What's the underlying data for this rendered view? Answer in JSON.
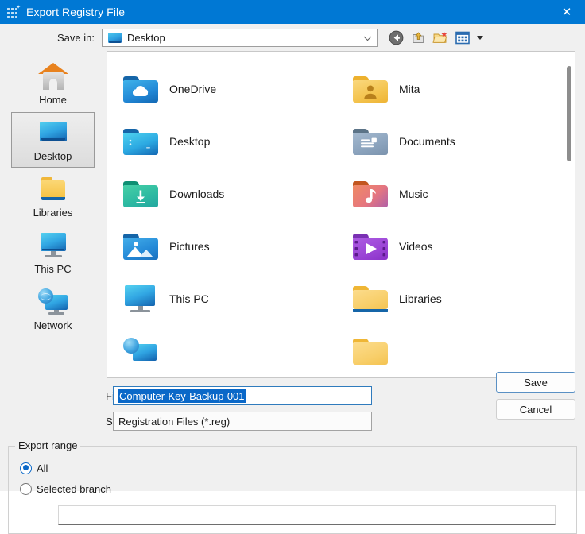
{
  "window": {
    "title": "Export Registry File",
    "title_icon": "registry-grid-icon",
    "close_label": "✕",
    "accent_color": "#0078d4"
  },
  "savein": {
    "label": "Save in:",
    "value": "Desktop",
    "icon": "desktop-monitor-icon"
  },
  "toolbar": [
    {
      "name": "back-icon",
      "tooltip": "Back"
    },
    {
      "name": "up-folder-icon",
      "tooltip": "Up one level"
    },
    {
      "name": "new-folder-icon",
      "tooltip": "Create New Folder"
    },
    {
      "name": "views-icon",
      "tooltip": "Views"
    }
  ],
  "places": [
    {
      "label": "Home",
      "icon": "home-icon",
      "selected": false
    },
    {
      "label": "Desktop",
      "icon": "desktop-icon",
      "selected": true
    },
    {
      "label": "Libraries",
      "icon": "libraries-folder-icon",
      "selected": false
    },
    {
      "label": "This PC",
      "icon": "this-pc-icon",
      "selected": false
    },
    {
      "label": "Network",
      "icon": "network-icon",
      "selected": false
    }
  ],
  "files": [
    {
      "name": "OneDrive",
      "icon": "onedrive-folder-icon",
      "color": "#2b9ae0",
      "tab": "#1565a8",
      "glyph": "cloud"
    },
    {
      "name": "Mita",
      "icon": "user-folder-icon",
      "color": "#f5c757",
      "tab": "#edb12e",
      "glyph": "person"
    },
    {
      "name": "Desktop",
      "icon": "desktop-folder-icon",
      "color": "#2fb6e0",
      "tab": "#1565a8",
      "glyph": "bars"
    },
    {
      "name": "Documents",
      "icon": "documents-folder-icon",
      "color": "#8ba3bd",
      "tab": "#5b7387",
      "glyph": "doc"
    },
    {
      "name": "Downloads",
      "icon": "downloads-folder-icon",
      "color": "#2fbfa0",
      "tab": "#0e8f73",
      "glyph": "arrow-down"
    },
    {
      "name": "Music",
      "icon": "music-folder-icon",
      "color": "#e98071",
      "tab": "#c2561f",
      "glyph": "note"
    },
    {
      "name": "Pictures",
      "icon": "pictures-folder-icon",
      "color": "#2b9ae0",
      "tab": "#1565a8",
      "glyph": "image"
    },
    {
      "name": "Videos",
      "icon": "videos-folder-icon",
      "color": "#9b45d6",
      "tab": "#7a31b3",
      "glyph": "play"
    },
    {
      "name": "This PC",
      "icon": "this-pc-icon",
      "color": "",
      "tab": "",
      "glyph": "monitor"
    },
    {
      "name": "Libraries",
      "icon": "libraries-folder-icon",
      "color": "#f8cf6b",
      "tab": "#efb635",
      "glyph": "libbar"
    }
  ],
  "form": {
    "file_name_label": "File name:",
    "file_name_value": "Computer-Key-Backup-001",
    "save_as_type_label": "Save as type:",
    "save_as_type_value": "Registration Files (*.reg)",
    "save_button": "Save",
    "cancel_button": "Cancel"
  },
  "export_range": {
    "legend": "Export range",
    "options": [
      {
        "label": "All",
        "checked": true
      },
      {
        "label": "Selected branch",
        "checked": false
      }
    ],
    "branch_value": ""
  }
}
